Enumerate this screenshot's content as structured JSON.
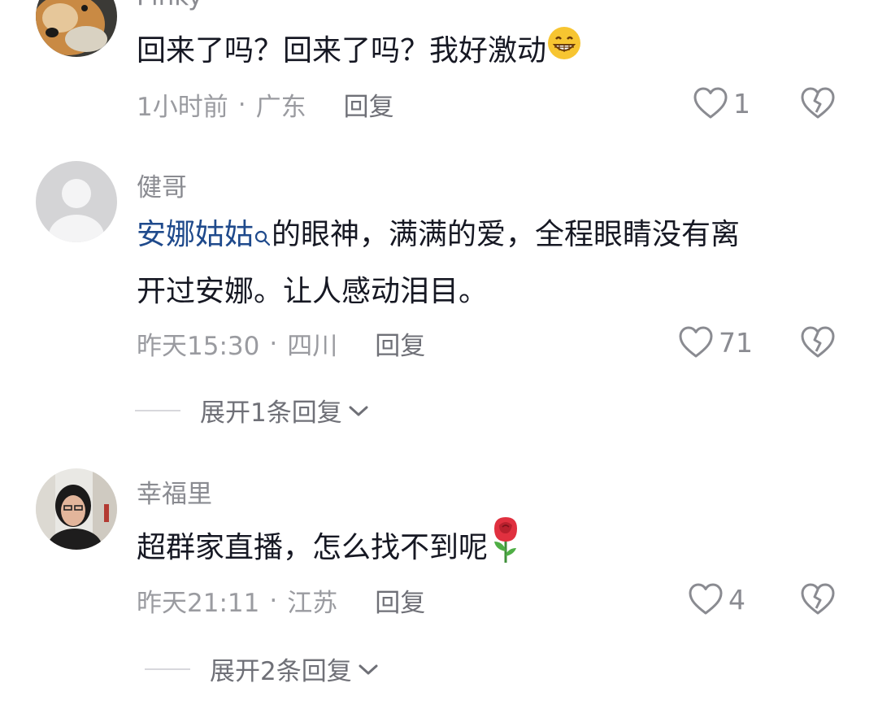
{
  "comments": [
    {
      "username": "Pinky",
      "text": "回来了吗？回来了吗？我好激动",
      "time": "1小时前",
      "location": "广东",
      "reply_label": "回复",
      "likes": "1",
      "emoji": "grinning-face"
    },
    {
      "username": "健哥",
      "mention": "安娜姑姑",
      "text_line1": "的眼神，满满的爱，全程眼睛没有离",
      "text_line2": "开过安娜。让人感动泪目。",
      "time": "昨天15:30",
      "location": "四川",
      "reply_label": "回复",
      "likes": "71",
      "expand_label": "展开1条回复"
    },
    {
      "username": "幸福里",
      "text": "超群家直播，怎么找不到呢",
      "time": "昨天21:11",
      "location": "江苏",
      "reply_label": "回复",
      "likes": "4",
      "emoji": "rose",
      "expand_label": "展开2条回复"
    }
  ],
  "separator": "·",
  "icons": {
    "like": "heart-outline-icon",
    "dislike": "broken-heart-icon",
    "expand": "chevron-down-icon",
    "search": "search-icon"
  },
  "colors": {
    "mention": "#1f4a8c",
    "meta": "#9a9ba0",
    "body": "#161823"
  }
}
